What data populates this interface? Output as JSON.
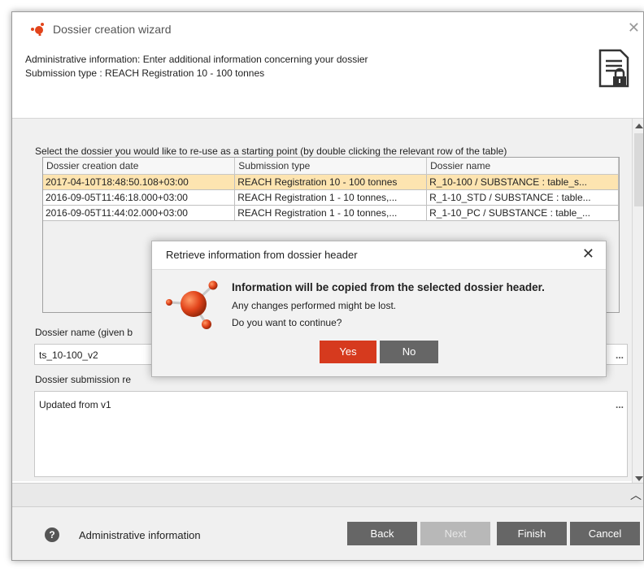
{
  "window": {
    "title": "Dossier creation wizard",
    "header_line1": "Administrative information: Enter additional information concerning your dossier",
    "header_line2": "Submission type : REACH Registration 10 - 100 tonnes"
  },
  "main": {
    "instruction": "Select the dossier you would like to re-use as a starting point (by double clicking the relevant row of the table)",
    "table": {
      "columns": [
        "Dossier creation date",
        "Submission type",
        "Dossier name"
      ],
      "rows": [
        [
          "2017-04-10T18:48:50.108+03:00",
          "REACH Registration 10 - 100 tonnes",
          "R_10-100 / SUBSTANCE : table_s..."
        ],
        [
          "2016-09-05T11:46:18.000+03:00",
          "REACH Registration 1 - 10 tonnes,...",
          "R_1-10_STD / SUBSTANCE : table..."
        ],
        [
          "2016-09-05T11:44:02.000+03:00",
          "REACH Registration 1 - 10 tonnes,...",
          "R_1-10_PC / SUBSTANCE : table_..."
        ]
      ],
      "selected_row": 0
    },
    "dossier_name_label": "Dossier name (given b",
    "dossier_name_value": "ts_10-100_v2",
    "remarks_label": "Dossier submission re",
    "remarks_value": "Updated from v1",
    "ellipsis": "..."
  },
  "footer": {
    "help_glyph": "?",
    "section_label": "Administrative information",
    "back": "Back",
    "next": "Next",
    "finish": "Finish",
    "cancel": "Cancel"
  },
  "dialog": {
    "title": "Retrieve information from dossier header",
    "message_bold": "Information will be copied from the selected dossier header.",
    "message_line2": "Any changes performed might be lost.",
    "message_line3": "Do you want to continue?",
    "yes": "Yes",
    "no": "No"
  },
  "colors": {
    "accent_red": "#d63a1e",
    "selected_row": "#fde4b0",
    "button_gray": "#666666",
    "disabled_button": "#b8b8b8"
  },
  "icons": {
    "app": "molecule-icon",
    "document_lock": "document-lock-icon",
    "dialog": "molecule-large-icon",
    "help": "help-icon",
    "close": "close-icon"
  }
}
